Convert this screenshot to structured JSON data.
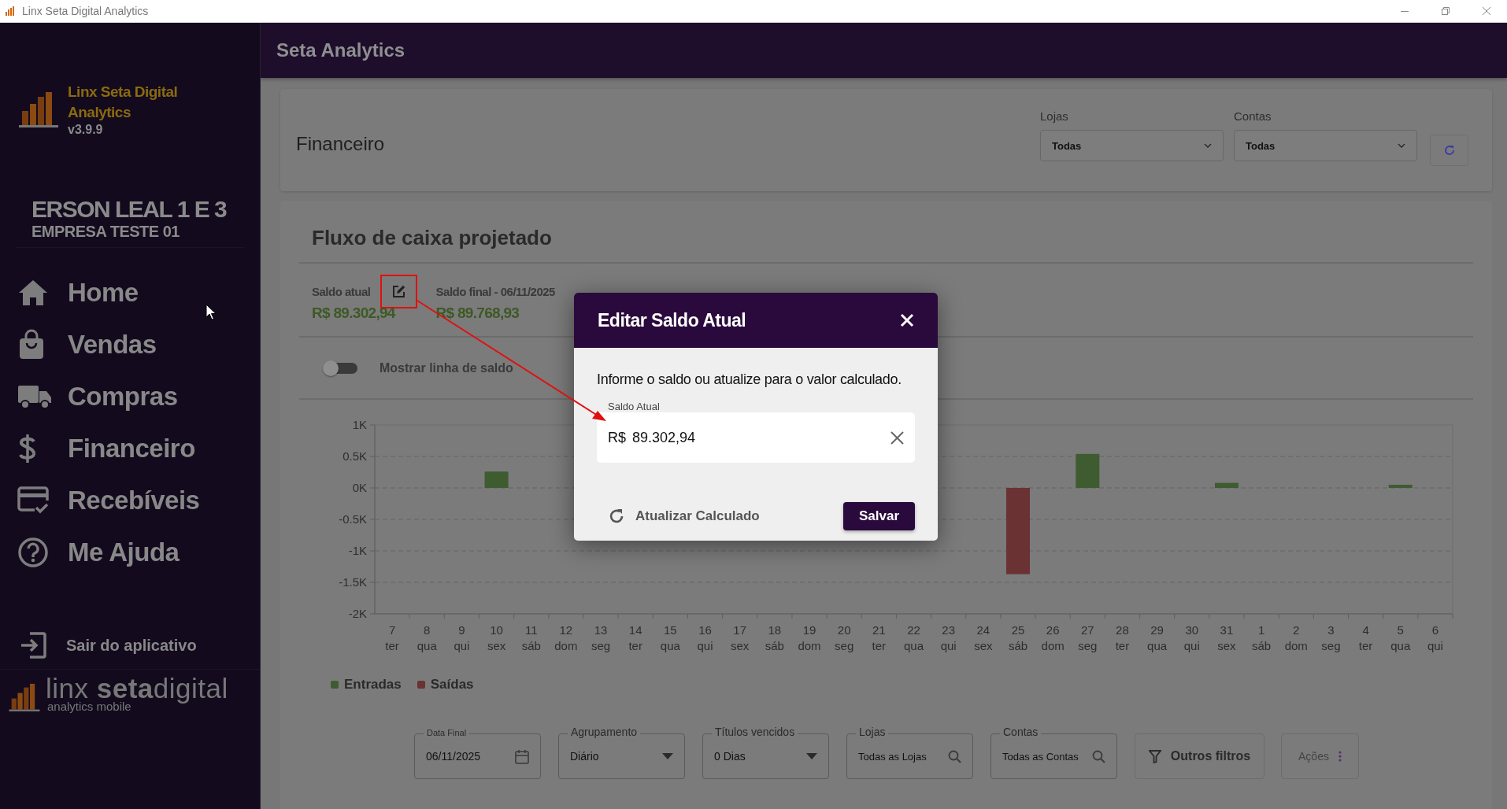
{
  "window": {
    "title": "Linx Seta Digital Analytics"
  },
  "sidebar": {
    "brand": {
      "name": "Linx Seta Digital Analytics",
      "version": "v3.9.9"
    },
    "company": {
      "user": "ERSON LEAL 1 E 3",
      "name": "EMPRESA TESTE 01"
    },
    "items": [
      {
        "label": "Home",
        "kind": "home"
      },
      {
        "label": "Vendas",
        "kind": "bag"
      },
      {
        "label": "Compras",
        "kind": "truck"
      },
      {
        "label": "Financeiro",
        "kind": "dollar"
      },
      {
        "label": "Recebíveis",
        "kind": "card"
      },
      {
        "label": "Me Ajuda",
        "kind": "help"
      }
    ],
    "logout": "Sair do aplicativo",
    "footer_logo": {
      "name": "linx **seta**digital",
      "tagline": "analytics mobile"
    }
  },
  "header": {
    "title": "Seta Analytics"
  },
  "page": {
    "title": "Financeiro",
    "filters": [
      {
        "label": "Lojas",
        "value": "Todas"
      },
      {
        "label": "Contas",
        "value": "Todas"
      }
    ]
  },
  "cash_flow": {
    "title": "Fluxo de caixa projetado",
    "balances": [
      {
        "label": "Saldo atual",
        "value": "R$ 89.302,94",
        "editable": true
      },
      {
        "label": "Saldo final - 06/11/2025",
        "value": "R$ 89.768,93",
        "editable": false
      }
    ],
    "toggle": {
      "label": "Mostrar linha de saldo",
      "on": false
    },
    "chart_data": {
      "type": "bar",
      "stacked": true,
      "grid": true,
      "categories": [
        "7 ter",
        "8 qua",
        "9 qui",
        "10 sex",
        "11 sáb",
        "12 dom",
        "13 seg",
        "14 ter",
        "15 qua",
        "16 qui",
        "17 sex",
        "18 sáb",
        "19 dom",
        "20 seg",
        "21 ter",
        "22 qua",
        "23 qui",
        "24 sex",
        "25 sáb",
        "26 dom",
        "27 seg",
        "28 ter",
        "29 qua",
        "30 qui",
        "31 sex",
        "1 sáb",
        "2 dom",
        "3 seg",
        "4 ter",
        "5 qua",
        "6 qui"
      ],
      "series": [
        {
          "name": "Entradas",
          "color": "#3e5c30",
          "values": [
            0,
            0,
            0,
            0.26,
            0,
            0,
            null,
            null,
            null,
            null,
            null,
            null,
            null,
            null,
            null,
            null,
            0,
            0,
            0,
            0,
            0.54,
            0,
            0,
            0,
            0.08,
            0,
            0,
            0,
            0,
            0.05,
            0
          ]
        },
        {
          "name": "Saídas",
          "color": "#6a3232",
          "values": [
            0,
            0,
            0,
            0,
            0,
            0,
            null,
            null,
            null,
            null,
            null,
            null,
            null,
            null,
            null,
            null,
            0,
            0,
            -1.37,
            0,
            0,
            0,
            0,
            0,
            0,
            0,
            0,
            0,
            0,
            0,
            0
          ]
        }
      ],
      "ylim": [
        -2,
        1
      ],
      "yticks": [
        {
          "value": 1,
          "label": "1K"
        },
        {
          "value": 0.5,
          "label": "0.5K"
        },
        {
          "value": 0,
          "label": "0K"
        },
        {
          "value": -0.5,
          "label": "-0.5K"
        },
        {
          "value": -1,
          "label": "-1K"
        },
        {
          "value": -1.5,
          "label": "-1.5K"
        },
        {
          "value": -2,
          "label": "-2K"
        }
      ]
    },
    "filters": [
      {
        "kind": "date",
        "label": "Data Final",
        "value": "06/11/2025"
      },
      {
        "kind": "select",
        "label": "Agrupamento",
        "value": "Diário"
      },
      {
        "kind": "select",
        "label": "Títulos vencidos",
        "value": "0 Dias"
      },
      {
        "kind": "search",
        "label": "Lojas",
        "value": "Todas as Lojas"
      },
      {
        "kind": "search",
        "label": "Contas",
        "value": "Todas as Contas"
      }
    ],
    "buttons": [
      {
        "kind": "filter",
        "label": "Outros filtros"
      },
      {
        "kind": "menu",
        "label": "Ações"
      }
    ]
  },
  "modal": {
    "title": "Editar Saldo Atual",
    "message": "Informe o saldo ou atualize para o valor calculado.",
    "field": {
      "label": "Saldo Atual",
      "prefix": "R$",
      "value": "89.302,94"
    },
    "refresh": "Atualizar Calculado",
    "save": "Salvar"
  },
  "callout": {
    "kind": "arrow"
  }
}
